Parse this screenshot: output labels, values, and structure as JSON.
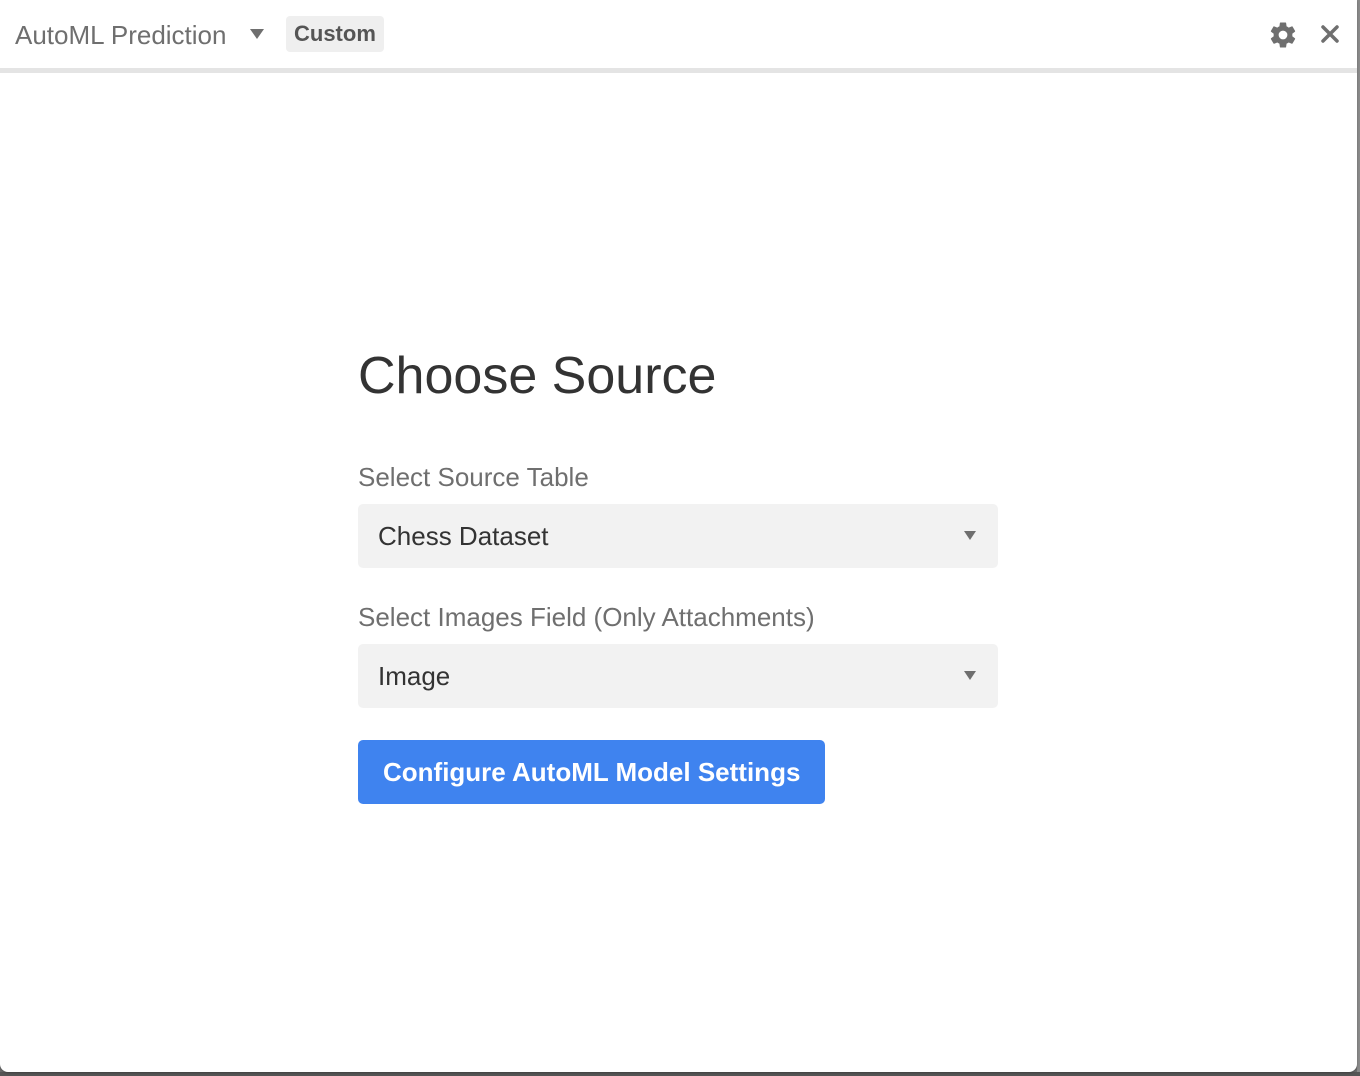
{
  "titlebar": {
    "app_name": "AutoML Prediction",
    "badge": "Custom",
    "icons": {
      "dropdown": "caret-down-icon",
      "settings": "gear-icon",
      "close": "close-icon"
    }
  },
  "main": {
    "heading": "Choose Source",
    "source_table": {
      "label": "Select Source Table",
      "value": "Chess Dataset"
    },
    "images_field": {
      "label": "Select Images Field (Only Attachments)",
      "value": "Image"
    },
    "primary_button": "Configure AutoML Model Settings"
  },
  "colors": {
    "accent": "#3f83ef",
    "select_bg": "#f2f2f2",
    "heading_text": "#333333",
    "muted_text": "#6f6f6f"
  }
}
